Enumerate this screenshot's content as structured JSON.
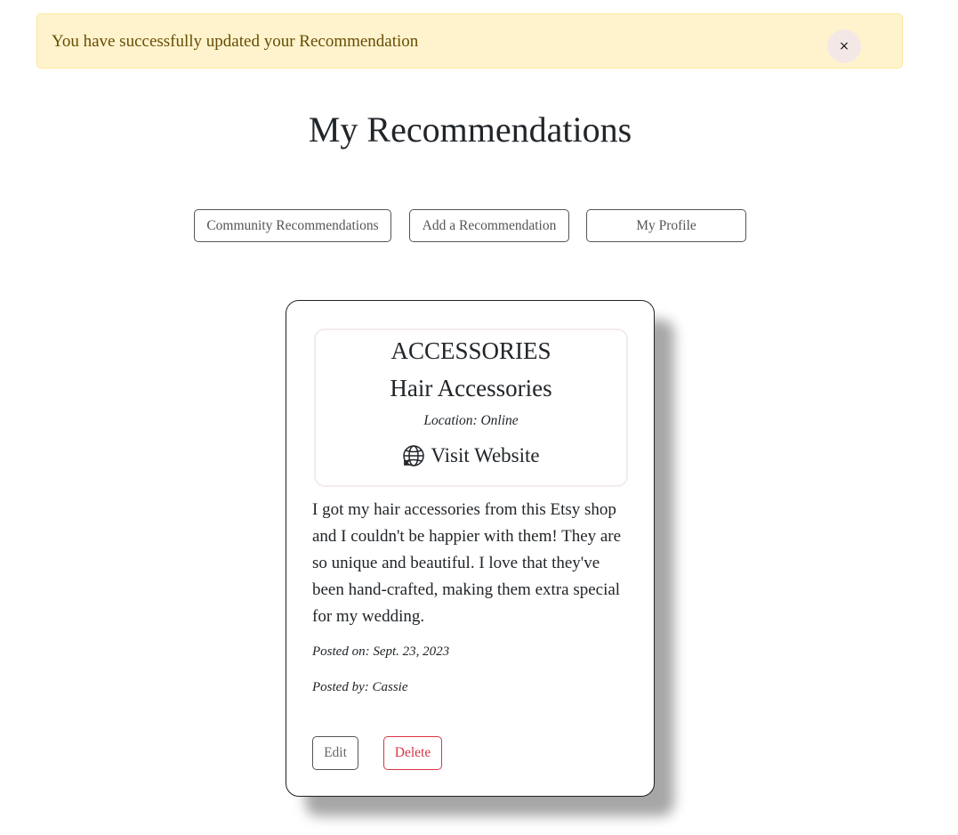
{
  "alert": {
    "message": "You have successfully updated your Recommendation",
    "close_label": "×"
  },
  "page": {
    "title": "My Recommendations"
  },
  "nav": {
    "community_label": "Community Recommendations",
    "add_label": "Add a Recommendation",
    "profile_label": "My Profile"
  },
  "recommendation": {
    "category": "ACCESSORIES",
    "title": "Hair Accessories",
    "location": "Location: Online",
    "website_label": "Visit Website",
    "website_icon": "globe-icon",
    "description": "I got my hair accessories from this Etsy shop and I couldn't be happier with them! They are so unique and beautiful. I love that they've been hand-crafted, making them extra special for my wedding.",
    "posted_on": "Posted on: Sept. 23, 2023",
    "posted_by": "Posted by: Cassie",
    "edit_label": "Edit",
    "delete_label": "Delete"
  },
  "colors": {
    "alert_bg": "#fff3cd",
    "alert_text": "#664d03",
    "danger": "#dc3545"
  }
}
